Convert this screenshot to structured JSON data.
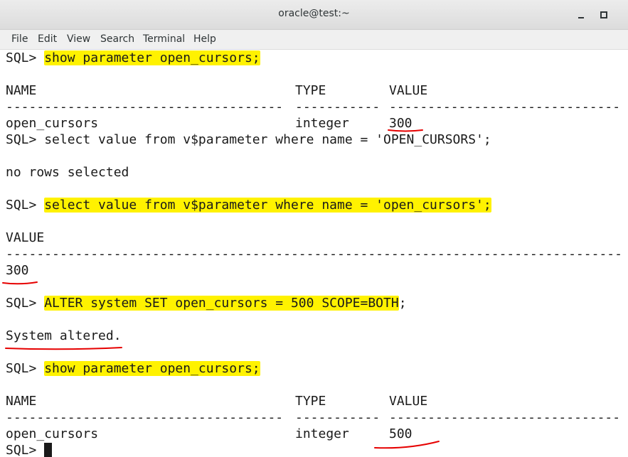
{
  "window": {
    "title": "oracle@test:~"
  },
  "menu": [
    "File",
    "Edit",
    "View",
    "Search",
    "Terminal",
    "Help"
  ],
  "terminal": {
    "prompt": "SQL> ",
    "cmd1": "show parameter open_cursors;",
    "header1": {
      "name": "NAME",
      "type": "TYPE",
      "value": "VALUE"
    },
    "sep1": {
      "name": "------------------------------------",
      "type": "-----------",
      "value": "------------------------------"
    },
    "row1": {
      "name": "open_cursors",
      "type": "integer",
      "value": "300"
    },
    "cmd2": "select value from v$parameter where name = 'OPEN_CURSORS';",
    "result2": "no rows selected",
    "cmd3": "select value from v$parameter where name = 'open_cursors';",
    "header3": "VALUE",
    "sep3": "--------------------------------------------------------------------------------",
    "value3": "300",
    "cmd4_highlight": "ALTER system SET open_cursors = 500 SCOPE=BOTH",
    "cmd4_tail": ";",
    "result4": "System altered.",
    "cmd5": "show parameter open_cursors;",
    "header5": {
      "name": "NAME",
      "type": "TYPE",
      "value": "VALUE"
    },
    "sep5": {
      "name": "------------------------------------",
      "type": "-----------",
      "value": "------------------------------"
    },
    "row5": {
      "name": "open_cursors",
      "type": "integer",
      "value": "500"
    }
  },
  "colors": {
    "highlight": "#fff200",
    "annotation": "#e60000",
    "text": "#1a1a1a"
  }
}
